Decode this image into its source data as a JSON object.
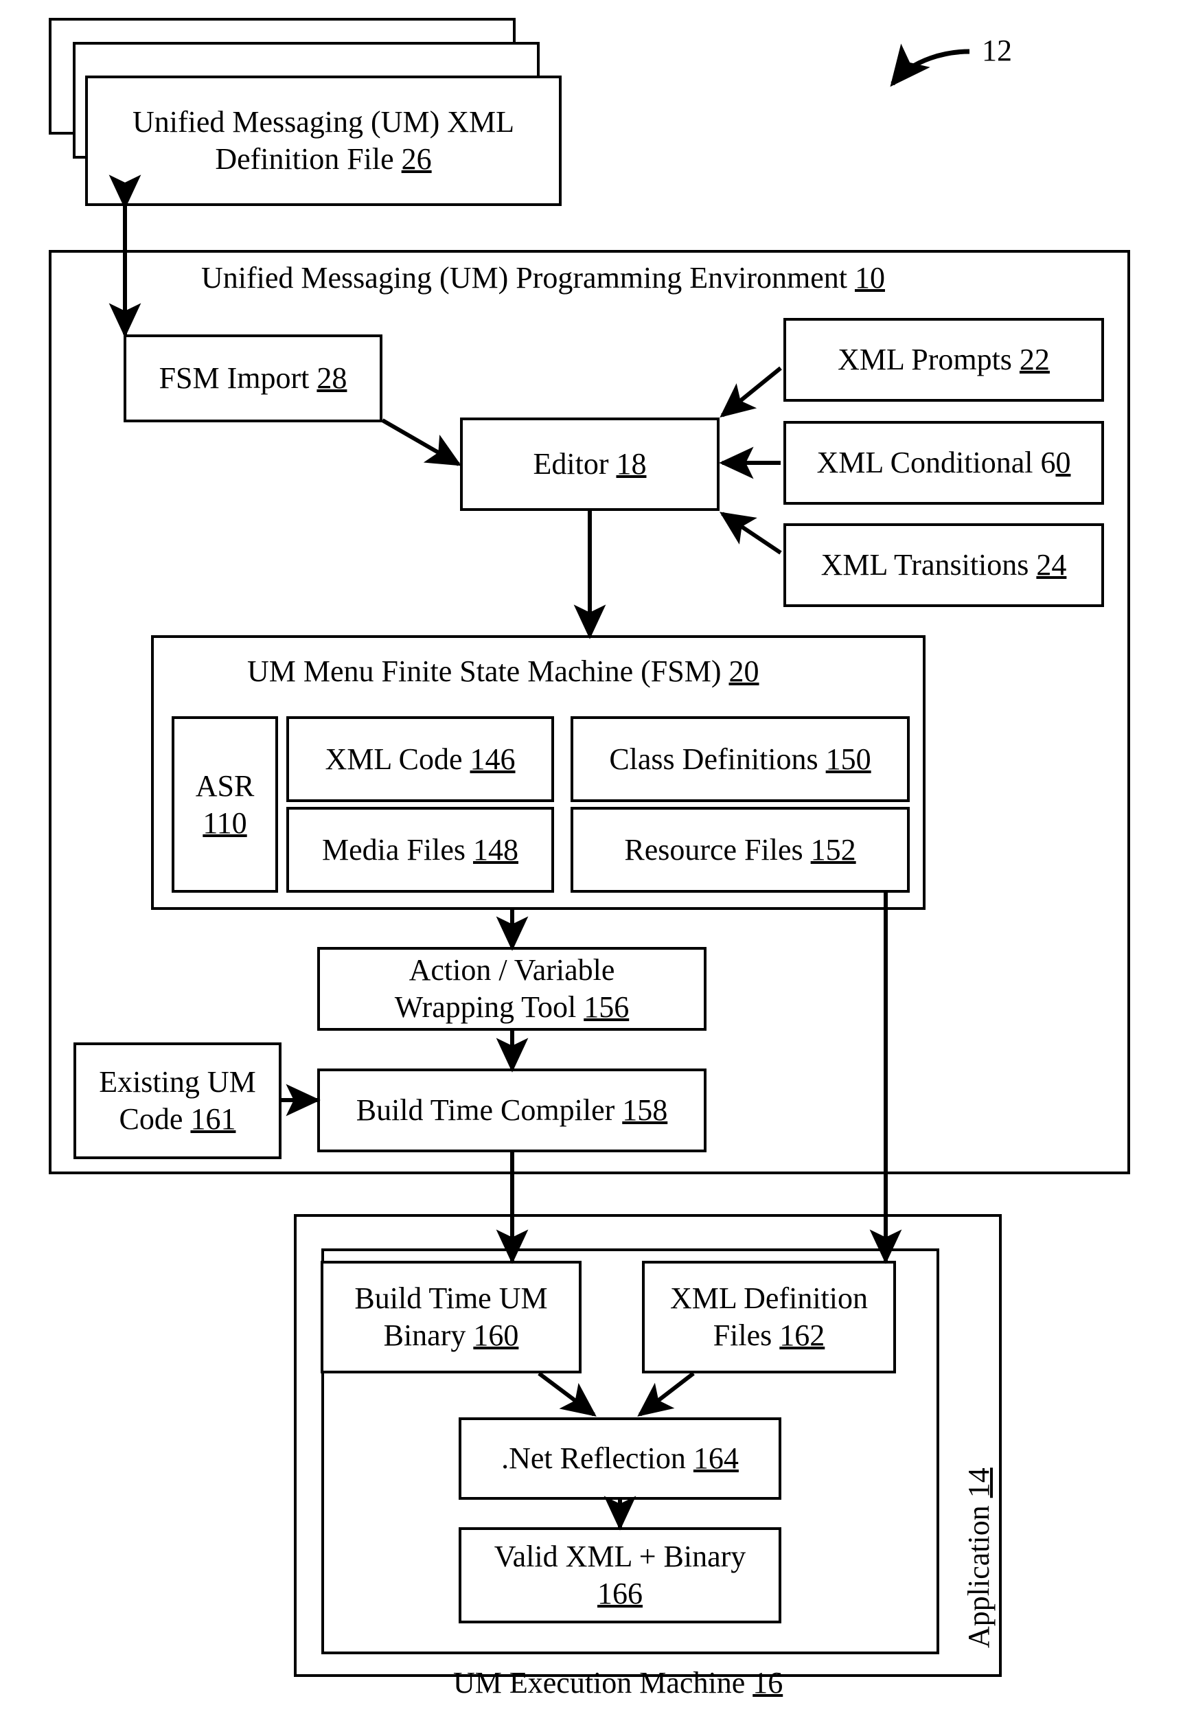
{
  "figure": {
    "reference_numeral": "12"
  },
  "xml_definition_file": {
    "line1": "Unified Messaging (UM) XML",
    "line2_text": "Definition File ",
    "line2_num": "26",
    "stack_count": 3
  },
  "environment": {
    "title_text": "Unified Messaging (UM) Programming Environment ",
    "title_num": "10",
    "fsm_import": {
      "text": "FSM Import ",
      "num": "28"
    },
    "editor": {
      "text": "Editor ",
      "num": "18"
    },
    "inputs": [
      {
        "name": "xml-prompts",
        "text": "XML Prompts ",
        "num": "22"
      },
      {
        "name": "xml-conditional",
        "text": "XML Conditional 6",
        "num": "0"
      },
      {
        "name": "xml-transitions",
        "text": "XML Transitions ",
        "num": "24"
      }
    ],
    "fsm": {
      "title_text": "UM Menu Finite State Machine (FSM) ",
      "title_num": "20",
      "asr": {
        "line1": "ASR",
        "line2_num": "110"
      },
      "items": [
        {
          "name": "xml-code",
          "text": "XML Code ",
          "num": "146"
        },
        {
          "name": "class-definitions",
          "text": "Class Definitions ",
          "num": "150"
        },
        {
          "name": "media-files",
          "text": "Media Files ",
          "num": "148"
        },
        {
          "name": "resource-files",
          "text": "Resource Files ",
          "num": "152"
        }
      ]
    },
    "wrapping_tool": {
      "line1": "Action / Variable",
      "line2_text": "Wrapping Tool ",
      "line2_num": "156"
    },
    "existing_um_code": {
      "line1": "Existing UM",
      "line2_text": "Code ",
      "line2_num": "161"
    },
    "build_time_compiler": {
      "text": "Build Time Compiler ",
      "num": "158"
    }
  },
  "application": {
    "side_label_text": "Application ",
    "side_label_num": "14",
    "execution_machine": {
      "title_text": "UM Execution Machine ",
      "title_num": "16",
      "build_time_um_binary": {
        "line1": "Build Time UM",
        "line2_text": "Binary ",
        "line2_num": "160"
      },
      "xml_definition_files": {
        "line1": "XML Definition",
        "line2_text": "Files ",
        "line2_num": "162"
      },
      "net_reflection": {
        "text": ".Net Reflection ",
        "num": "164"
      },
      "valid_xml_binary": {
        "line1": "Valid XML + Binary",
        "line2_num": "166"
      }
    }
  },
  "colors": {
    "stroke": "#000000",
    "background": "#ffffff"
  }
}
